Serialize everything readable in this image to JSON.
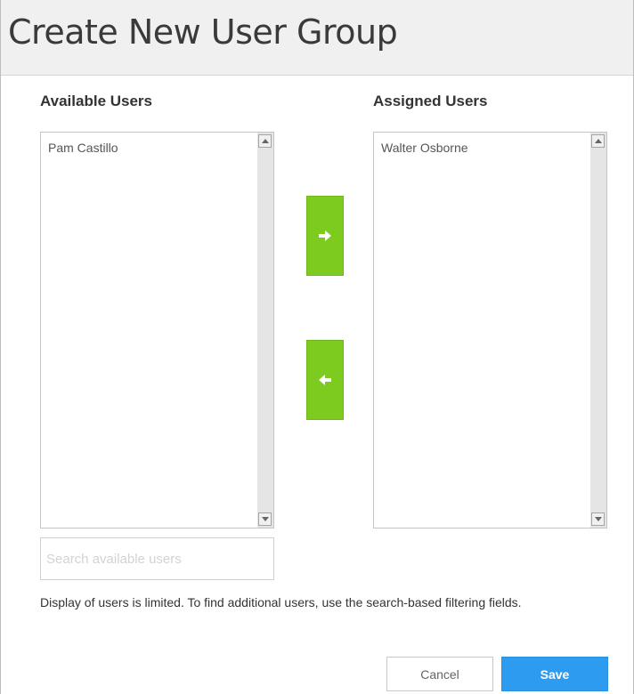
{
  "dialog": {
    "title": "Create New User Group"
  },
  "available": {
    "heading": "Available Users",
    "users": [
      "Pam Castillo"
    ],
    "search_placeholder": "Search available users"
  },
  "assigned": {
    "heading": "Assigned Users",
    "users": [
      "Walter Osborne"
    ]
  },
  "note": "Display of users is limited. To find additional users, use the search-based filtering fields.",
  "actions": {
    "cancel_label": "Cancel",
    "save_label": "Save"
  },
  "colors": {
    "move_button": "#7ecb1f",
    "save_button": "#2d9cf0"
  },
  "icons": {
    "move_right": "arrow-right-icon",
    "move_left": "arrow-left-icon"
  }
}
